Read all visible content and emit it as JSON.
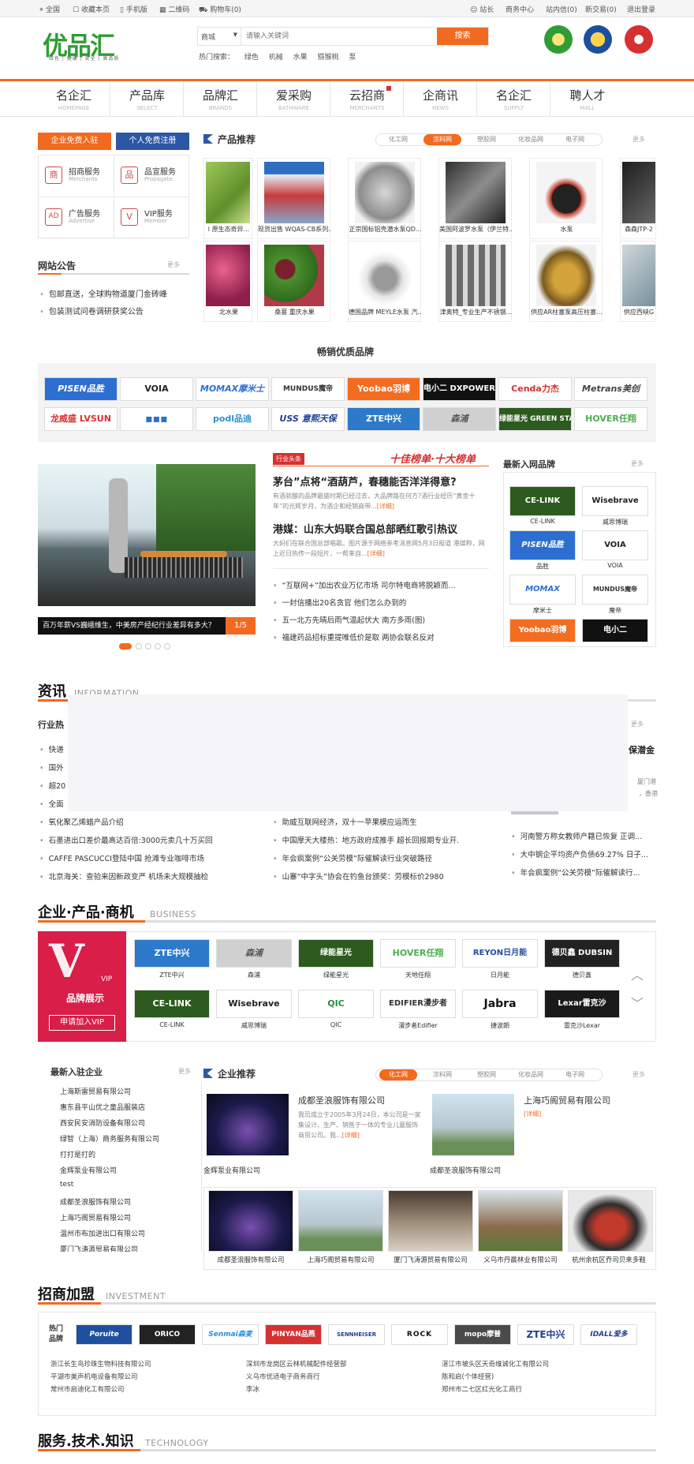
{
  "topbar": {
    "items_left": [
      "全国",
      "收藏本页",
      "手机版",
      "二维码",
      "购物车(0)"
    ],
    "items_right": [
      "站长",
      "商务中心",
      "站内信(0)",
      "新交易(0)",
      "退出登录"
    ]
  },
  "header": {
    "logo_text": "优品汇",
    "logo_tagline": "绿色 | 健康 | 安全 | 高品质",
    "search": {
      "type": "商城",
      "placeholder": "请输入关键词",
      "button": "搜索"
    },
    "hot_label": "热门搜索：",
    "hot_items": [
      "绿色",
      "机械",
      "水果",
      "猕猴桃",
      "泵"
    ]
  },
  "nav": [
    {
      "cn": "名企汇",
      "en": "HOMEPAGE"
    },
    {
      "cn": "产品库",
      "en": "SELECT"
    },
    {
      "cn": "品牌汇",
      "en": "BRANDS"
    },
    {
      "cn": "爱采购",
      "en": "BATHWARE"
    },
    {
      "cn": "云招商",
      "en": "MERCHANTS"
    },
    {
      "cn": "企商讯",
      "en": "NEWS"
    },
    {
      "cn": "名企汇",
      "en": "SUPPLY"
    },
    {
      "cn": "聘人才",
      "en": "MALL"
    }
  ],
  "left": {
    "register_company": "企业免费入驻",
    "register_person": "个人免费注册",
    "services": [
      {
        "title": "招商服务",
        "en": "Merchants",
        "icon": "商"
      },
      {
        "title": "品宣服务",
        "en": "Propagate",
        "icon": "品"
      },
      {
        "title": "广告服务",
        "en": "Advertise",
        "icon": "AD"
      },
      {
        "title": "VIP服务",
        "en": "Member",
        "icon": "V"
      }
    ],
    "notice_title": "网站公告",
    "notice_more": "更多",
    "notices": [
      "包邮直送，全球购物道厦门金砖峰",
      "包装测试问卷调研获奖公告"
    ]
  },
  "products": {
    "title": "产品推荐",
    "tabs": [
      "化工网",
      "涂料网",
      "塑胶网",
      "化妆品网",
      "电子网"
    ],
    "active_tab": "涂料网",
    "more": "更多",
    "row1": [
      "l 原生态奇异...",
      "现货出售 WQAS-CB系列...",
      "正宗国标铝壳潜水泵QD...",
      "美国阿波罗水泵（伊兰特...",
      "水泵",
      "森森JTP-2"
    ],
    "row2": [
      "北水果",
      "桑葚 重庆水果",
      "德国品牌 MEYLE水泵 汽...",
      "津奥特_专业生产不锈钢...",
      "供应AR柱塞泵高压柱塞...",
      "供应西峡G"
    ]
  },
  "brands": {
    "title": "畅销优质品牌",
    "row1": [
      "PISEN品胜",
      "VOIA",
      "MOMAX摩米士",
      "MUNDUS魔帝",
      "Yoobao羽博",
      "电小二 DXPOWER",
      "Cenda力杰",
      "Metrans美创"
    ],
    "row2": [
      "龙威盛 LVSUN",
      "▪▪▪",
      "podl品迪",
      "USS 意熙天保",
      "ZTE中兴",
      "森浦",
      "绿能星光 GREEN STAR",
      "HOVER任翔"
    ]
  },
  "headline": {
    "slide_caption": "百万年薪VS巍峨维生，中美房产经纪行业差异有多大？",
    "slide_counter": "1/5",
    "badge": "行业头条",
    "banner": "十佳榜单·十大榜单",
    "h1": "茅台”点将“酒葫芦，春穗能否洋洋得意?",
    "p1": "有酒就酿的品牌最盛时期已经过去，大品牌路在何方?酒行业经历“黄金十年”的光辉岁月，为酒企和经销商带...",
    "h2": "港媒：山东大妈联合国总部晒红歌引热议",
    "p2": "大妈们在联合国总部唱歌。图片源于网络参考消息网5月3日报道 港媒称，网上近日热传一段短片，一帮来自...",
    "detail": "[详细]",
    "bullets": [
      "“互联网+”加出农业万亿市场 司尔特电商将脱颖而...",
      "一封信播出20名贪官 他们怎么办到的",
      "五一北方先晴后雨气温起伏大 南方多雨(图)",
      "福建药品招标重提唯低价是取 两协会联名反对"
    ]
  },
  "newbrands": {
    "title": "最新入网品牌",
    "more": "更多",
    "items": [
      {
        "logo": "CE-LINK",
        "cap": "CE-LINK"
      },
      {
        "logo": "Wisebrave",
        "cap": "威思博瑞"
      },
      {
        "logo": "PISEN品胜",
        "cap": "品胜"
      },
      {
        "logo": "VOIA",
        "cap": "VOIA"
      },
      {
        "logo": "MOMAX",
        "cap": "摩米士"
      },
      {
        "logo": "MUNDUS魔帝",
        "cap": "魔帝"
      },
      {
        "logo": "Yoobao羽博",
        "cap": ""
      },
      {
        "logo": "电小二",
        "cap": ""
      }
    ]
  },
  "info": {
    "title": "资讯",
    "title_en": "INFORMATION",
    "industry": "行业热",
    "more": "更多",
    "left_items": [
      "快递",
      "国外",
      "超20",
      "全面",
      "氧化聚乙烯蜡产品介绍",
      "石墨进出口差价最高达百倍:3000元卖几十万买回",
      "CAFFE PASCUCCI登陆中国 抢滩专业咖啡市场",
      "北京海关：查验来因新政变严 机场未大规模抽检"
    ],
    "mid_items": [
      "助威互联网经济，双十一苹果模应运而生",
      "中国摩天大楼热：地方政府成推手 超长回报期专业开.",
      "年会疯案例“公关劳模”际催解读行业突破路径",
      "山寨“中字头”协会在钓鱼台颁奖：劳模标价2980"
    ],
    "right_title": "保潜金",
    "right_text1": "厦门港",
    "right_text2": "，香港",
    "right_items": [
      "河南警方称女教师产籍已恢复 正调...",
      "大中钢企平均资产负债69.27% 日子...",
      "年会疯案例“公关劳模”际催解读行..."
    ]
  },
  "business": {
    "title": "企业·产品·商机",
    "title_en": "BUSINESS",
    "vip_letter": "V",
    "vip_tag": "VIP",
    "vip_title": "品牌展示",
    "vip_btn": "申请加入VIP",
    "row1": [
      {
        "logo": "ZTE中兴",
        "cap": "ZTE中兴"
      },
      {
        "logo": "森浦",
        "cap": "森浦"
      },
      {
        "logo": "绿能星光",
        "cap": "绿能星光"
      },
      {
        "logo": "HOVER任翔",
        "cap": "天地任翔"
      },
      {
        "logo": "REYON日月能",
        "cap": "日月能"
      },
      {
        "logo": "德贝鑫 DUBSIN",
        "cap": "德贝鑫"
      }
    ],
    "row2": [
      {
        "logo": "CE-LINK",
        "cap": "CE-LINK"
      },
      {
        "logo": "Wisebrave",
        "cap": "威思博瑞"
      },
      {
        "logo": "QIC",
        "cap": "QIC"
      },
      {
        "logo": "EDIFIER漫步者",
        "cap": "漫步者Edifier"
      },
      {
        "logo": "Jabra",
        "cap": "捷波朗"
      },
      {
        "logo": "Lexar雷克沙",
        "cap": "雷克沙Lexar"
      }
    ]
  },
  "companies": {
    "new_title": "最新入驻企业",
    "more": "更多",
    "list": [
      "上海斯雷贸易有限公司",
      "惠东县平山优之童品服装店",
      "西安民安消防设备有限公司",
      "绿智（上海）商务服务有限公司",
      "打打是打的",
      "金辉泵业有限公司",
      "test",
      "成都圣浪服饰有限公司",
      "上海巧阁贸易有限公司",
      "温州市布加进出口有限公司",
      "厦门飞涛源贸易有限公司"
    ],
    "rec_title": "企业推荐",
    "tabs": [
      "化工网",
      "涂料网",
      "塑胶网",
      "化妆品网",
      "电子网"
    ],
    "active_tab": "化工网",
    "feat1_name": "成都圣浪服饰有限公司",
    "feat1_desc": "我司成立于2005年3月24日，本公司是一家集设计、生产、销售于一体的专业儿童服饰商贸公司。我...",
    "feat1_detail": "[详细]",
    "feat2_name": "上海巧阁贸易有限公司",
    "feat2_detail": "[详细]",
    "cap_a": "金辉泵业有限公司",
    "cap_b": "成都圣浪服饰有限公司",
    "photos": [
      "成都圣浪服饰有限公司",
      "上海巧阁贸易有限公司",
      "厦门飞涛源贸易有限公司",
      "义乌市丹晨林业有限公司",
      "杭州余杭区乔司贝来多鞋"
    ]
  },
  "invest": {
    "title": "招商加盟",
    "title_en": "INVESTMENT",
    "hot_label": "热门品牌",
    "logos": [
      "Poruite",
      "ORICO",
      "Senmai森麦",
      "PINYAN品燕",
      "SENNHEISER",
      "ROCK",
      "mopo摩普",
      "ZTE中兴",
      "IDALL爱多"
    ],
    "col1": [
      "浙江长生鸟珍珠生物科技有限公司",
      "平湖市美声机电设备有限公司",
      "常州市启迪化工有限公司"
    ],
    "col2": [
      "深圳市龙岗区云林机械配件经营部",
      "义乌市优适电子商务商行",
      "李冰"
    ],
    "col3": [
      "湛江市坡头区天奇维诚化工有限公司",
      "陈和启(个体经营)",
      "郑州市二七区红光化工商行"
    ]
  },
  "tech": {
    "title": "服务.技术.知识",
    "title_en": "TECHNOLOGY"
  }
}
